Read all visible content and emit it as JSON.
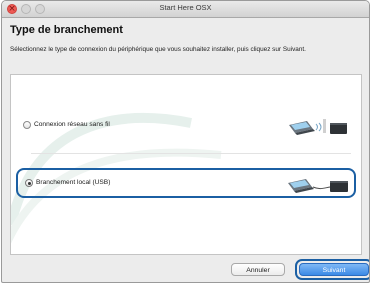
{
  "window": {
    "title": "Start Here OSX",
    "close_symbol": "×"
  },
  "page": {
    "title": "Type de branchement",
    "instruction": "Sélectionnez le type de connexion du périphérique que vous souhaitez installer, puis cliquez sur Suivant."
  },
  "options": [
    {
      "label": "Connexion réseau sans fil",
      "selected": false,
      "icon": "wireless-network-icon"
    },
    {
      "label": "Branchement local (USB)",
      "selected": true,
      "icon": "usb-connection-icon"
    }
  ],
  "buttons": {
    "cancel": "Annuler",
    "next": "Suivant"
  },
  "colors": {
    "highlight": "#1b5fa3",
    "primary_button": "#3b8ae6",
    "close_button": "#ee5a55"
  }
}
